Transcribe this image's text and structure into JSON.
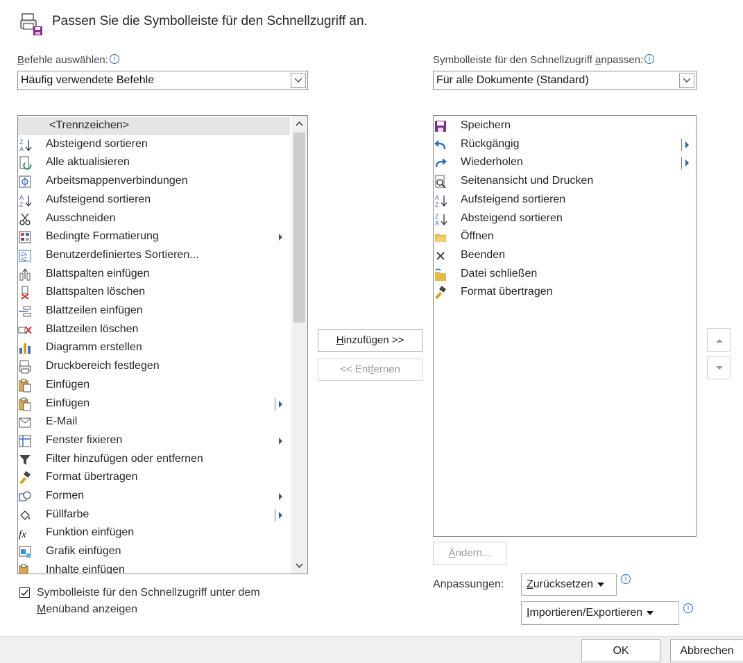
{
  "header": {
    "title": "Passen Sie die Symbolleiste für den Schnellzugriff an."
  },
  "left": {
    "label_u": "B",
    "label_rest": "efehle auswählen:",
    "combo_value": "Häufig verwendete Befehle",
    "items": [
      {
        "label": "<Trennzeichen>",
        "icon": "separator",
        "selected": true
      },
      {
        "label": "Absteigend sortieren",
        "icon": "sort-descending-icon"
      },
      {
        "label": "Alle aktualisieren",
        "icon": "refresh-all-icon"
      },
      {
        "label": "Arbeitsmappenverbindungen",
        "icon": "workbook-connections-icon"
      },
      {
        "label": "Aufsteigend sortieren",
        "icon": "sort-ascending-icon"
      },
      {
        "label": "Ausschneiden",
        "icon": "cut-icon"
      },
      {
        "label": "Bedingte Formatierung",
        "icon": "conditional-formatting-icon",
        "submenu": "plain"
      },
      {
        "label": "Benutzerdefiniertes Sortieren...",
        "icon": "custom-sort-icon"
      },
      {
        "label": "Blattspalten einfügen",
        "icon": "insert-columns-icon"
      },
      {
        "label": "Blattspalten löschen",
        "icon": "delete-columns-icon"
      },
      {
        "label": "Blattzeilen einfügen",
        "icon": "insert-rows-icon"
      },
      {
        "label": "Blattzeilen löschen",
        "icon": "delete-rows-icon"
      },
      {
        "label": "Diagramm erstellen",
        "icon": "chart-icon"
      },
      {
        "label": "Druckbereich festlegen",
        "icon": "print-area-icon"
      },
      {
        "label": "Einfügen",
        "icon": "paste-icon"
      },
      {
        "label": "Einfügen",
        "icon": "paste-icon",
        "submenu": "split"
      },
      {
        "label": "E-Mail",
        "icon": "email-icon"
      },
      {
        "label": "Fenster fixieren",
        "icon": "freeze-panes-icon",
        "submenu": "plain"
      },
      {
        "label": "Filter hinzufügen oder entfernen",
        "icon": "filter-icon"
      },
      {
        "label": "Format übertragen",
        "icon": "format-painter-icon"
      },
      {
        "label": "Formen",
        "icon": "shapes-icon",
        "submenu": "plain"
      },
      {
        "label": "Füllfarbe",
        "icon": "fill-color-icon",
        "submenu": "split"
      },
      {
        "label": "Funktion einfügen",
        "icon": "insert-function-icon"
      },
      {
        "label": "Grafik einfügen",
        "icon": "insert-picture-icon"
      },
      {
        "label": "Inhalte einfügen",
        "icon": "paste-special-icon"
      }
    ],
    "scroll_position": 0.0
  },
  "right": {
    "label_pre": "Symbolleiste für den Schnellzugriff ",
    "label_u": "a",
    "label_post": "npassen:",
    "combo_value": "Für alle Dokumente (Standard)",
    "items": [
      {
        "label": "Speichern",
        "icon": "save-icon"
      },
      {
        "label": "Rückgängig",
        "icon": "undo-icon",
        "submenu": "split"
      },
      {
        "label": "Wiederholen",
        "icon": "redo-icon",
        "submenu": "split"
      },
      {
        "label": "Seitenansicht und Drucken",
        "icon": "print-preview-icon"
      },
      {
        "label": "Aufsteigend sortieren",
        "icon": "sort-ascending-icon"
      },
      {
        "label": "Absteigend sortieren",
        "icon": "sort-descending-icon"
      },
      {
        "label": "Öffnen",
        "icon": "open-folder-icon"
      },
      {
        "label": "Beenden",
        "icon": "close-x-icon"
      },
      {
        "label": "Datei schließen",
        "icon": "close-file-icon"
      },
      {
        "label": "Format übertragen",
        "icon": "format-painter-icon"
      }
    ]
  },
  "buttons": {
    "add_u": "H",
    "add_rest": "inzufügen >>",
    "remove_pre": "<< Ent",
    "remove_u": "f",
    "remove_post": "ernen",
    "modify_u": "Ä",
    "modify_rest": "ndern...",
    "ok": "OK",
    "cancel": "Abbrechen"
  },
  "customizations": {
    "label": "Anpassungen:",
    "reset_u": "Z",
    "reset_rest": "urücksetzen",
    "import_u": "I",
    "import_rest": "mportieren/Exportieren"
  },
  "checkbox": {
    "checked": true,
    "line1": "Symbolleiste für den Schnellzugriff unter dem",
    "line2_u": "M",
    "line2_rest": "enüband anzeigen"
  },
  "colors": {
    "accent": "#2a6ecc",
    "selected_row": "#e5e5e5",
    "footer": "#f0f0f0"
  }
}
